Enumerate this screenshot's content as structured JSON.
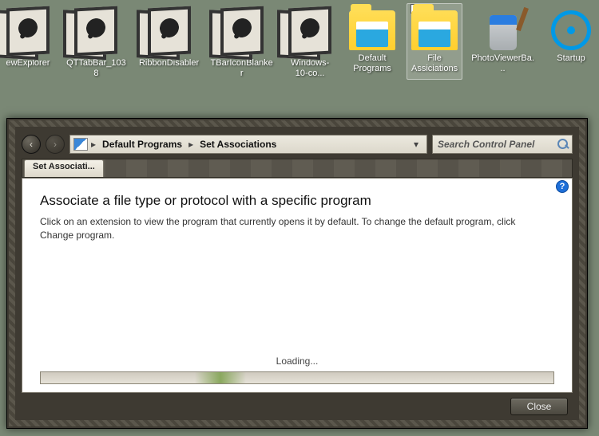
{
  "desktop": {
    "items": [
      {
        "label": "ewExplorer",
        "kind": "frame"
      },
      {
        "label": "QTTabBar_1038",
        "kind": "frame"
      },
      {
        "label": "RibbonDisabler",
        "kind": "frame"
      },
      {
        "label": "TBarIconBlanker",
        "kind": "frame"
      },
      {
        "label": "Windows-10-co...",
        "kind": "frame"
      },
      {
        "label": "Default Programs",
        "kind": "folder"
      },
      {
        "label": "File Assiciations",
        "kind": "folder",
        "selected": true,
        "checked": true
      },
      {
        "label": "PhotoViewerBa...",
        "kind": "bucket"
      },
      {
        "label": "Startup",
        "kind": "bluecircle"
      }
    ]
  },
  "window": {
    "breadcrumb": [
      "Default Programs",
      "Set Associations"
    ],
    "search_placeholder": "Search Control Panel",
    "tab_label": "Set Associati...",
    "help_badge": "?",
    "heading": "Associate a file type or protocol with a specific program",
    "body": "Click on an extension to view the program that currently opens it by default. To change the default program, click Change program.",
    "loading_label": "Loading...",
    "close_label": "Close"
  }
}
